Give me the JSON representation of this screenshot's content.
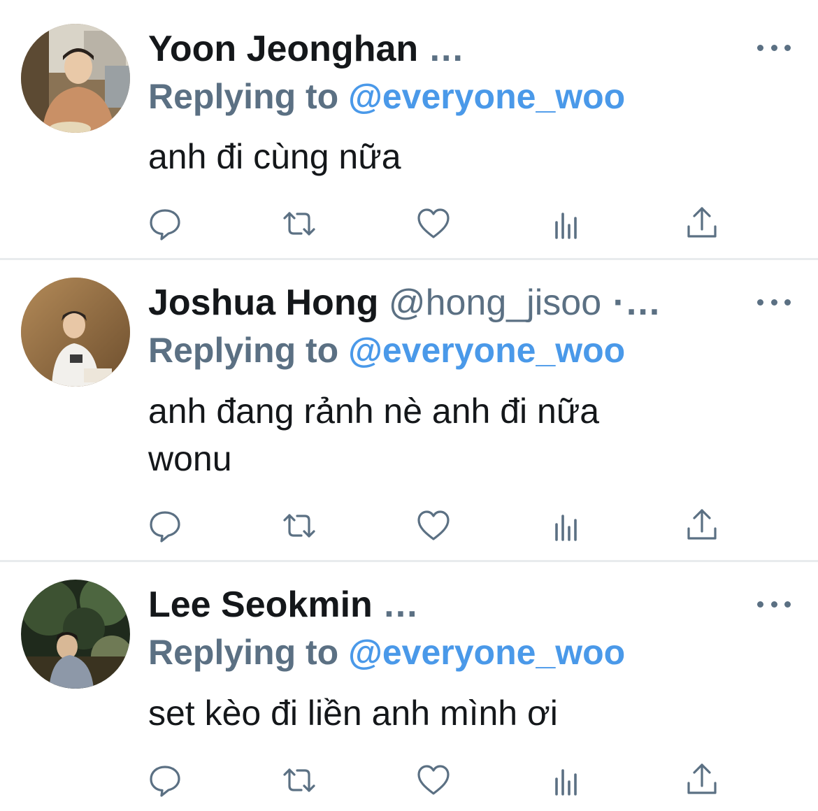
{
  "tweets": [
    {
      "name": "Yoon Jeonghan",
      "handle": "",
      "trail": " ...",
      "replying_prefix": "Replying to ",
      "replying_mention": "@everyone_woo",
      "text": "anh đi cùng nữa"
    },
    {
      "name": "Joshua Hong",
      "handle": " @hong_jisoo",
      "trail": " ·...",
      "replying_prefix": "Replying to ",
      "replying_mention": "@everyone_woo",
      "text": "anh đang rảnh nè anh đi nữa\nwonu"
    },
    {
      "name": "Lee Seokmin",
      "handle": "",
      "trail": " ...",
      "replying_prefix": "Replying to ",
      "replying_mention": "@everyone_woo",
      "text": "set kèo đi liền anh mình ơi"
    }
  ],
  "icons": [
    "reply-icon",
    "retweet-icon",
    "like-icon",
    "stats-icon",
    "share-icon",
    "more-icon"
  ],
  "colors": {
    "name": "#14171a",
    "secondary": "#5b7083",
    "mention": "#4a99e9",
    "separator": "#e8ebed",
    "background": "#ffffff"
  }
}
